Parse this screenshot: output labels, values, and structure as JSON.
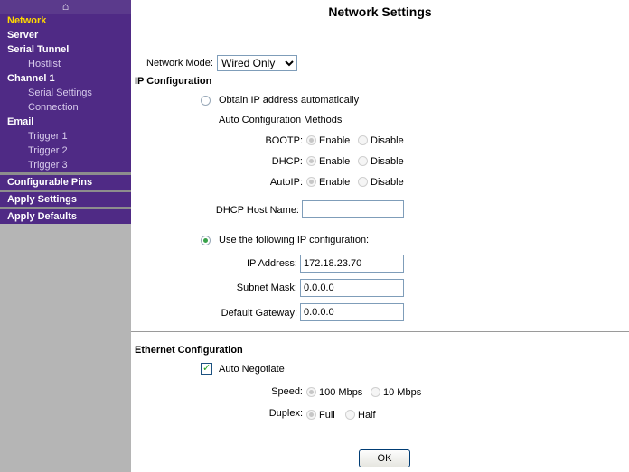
{
  "page": {
    "title": "Network Settings"
  },
  "sidebar": {
    "home_icon": "house-icon",
    "items": [
      {
        "label": "Network",
        "type": "section",
        "active": true
      },
      {
        "label": "Server",
        "type": "section"
      },
      {
        "label": "Serial Tunnel",
        "type": "section"
      },
      {
        "label": "Hostlist",
        "type": "sub"
      },
      {
        "label": "Channel 1",
        "type": "section"
      },
      {
        "label": "Serial Settings",
        "type": "sub"
      },
      {
        "label": "Connection",
        "type": "sub"
      },
      {
        "label": "Email",
        "type": "section"
      },
      {
        "label": "Trigger 1",
        "type": "sub"
      },
      {
        "label": "Trigger 2",
        "type": "sub"
      },
      {
        "label": "Trigger 3",
        "type": "sub"
      },
      {
        "label": "Configurable Pins",
        "type": "section"
      },
      {
        "label": "Apply Settings",
        "type": "section"
      },
      {
        "label": "Apply Defaults",
        "type": "section"
      }
    ]
  },
  "network_mode": {
    "label": "Network Mode:",
    "value": "Wired Only"
  },
  "ip_config": {
    "heading": "IP Configuration",
    "obtain_auto": "Obtain IP address automatically",
    "auto_methods": "Auto Configuration Methods",
    "bootp": "BOOTP:",
    "dhcp": "DHCP:",
    "autoip": "AutoIP:",
    "enable": "Enable",
    "disable": "Disable",
    "dhcp_host_name": "DHCP Host Name:",
    "dhcp_host_value": "",
    "use_following": "Use the following IP configuration:",
    "ip_address_label": "IP Address:",
    "ip_address_value": "172.18.23.70",
    "subnet_label": "Subnet Mask:",
    "subnet_value": "0.0.0.0",
    "gateway_label": "Default Gateway:",
    "gateway_value": "0.0.0.0"
  },
  "ethernet": {
    "heading": "Ethernet Configuration",
    "auto_negotiate": "Auto Negotiate",
    "speed_label": "Speed:",
    "speed_100": "100 Mbps",
    "speed_10": "10 Mbps",
    "duplex_label": "Duplex:",
    "duplex_full": "Full",
    "duplex_half": "Half"
  },
  "ok_button": "OK"
}
